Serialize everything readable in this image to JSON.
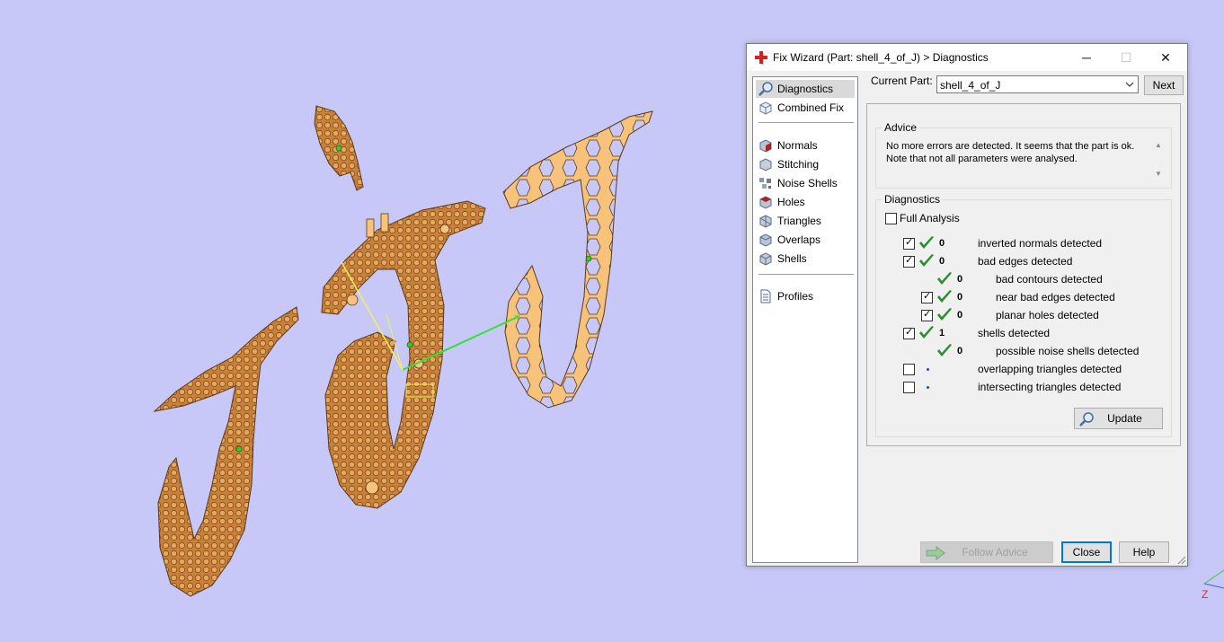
{
  "dialog": {
    "title": "Fix Wizard (Part: shell_4_of_J) > Diagnostics",
    "window_controls": {
      "minimize": "─",
      "maximize": "☐",
      "close": "✕"
    }
  },
  "nav": {
    "top_items": [
      {
        "label": "Diagnostics",
        "icon": "magnifier-icon",
        "selected": true
      },
      {
        "label": "Combined Fix",
        "icon": "cube-wire-icon"
      }
    ],
    "fix_items": [
      {
        "label": "Normals",
        "icon": "normals-icon"
      },
      {
        "label": "Stitching",
        "icon": "stitching-icon"
      },
      {
        "label": "Noise Shells",
        "icon": "noise-shells-icon"
      },
      {
        "label": "Holes",
        "icon": "holes-icon"
      },
      {
        "label": "Triangles",
        "icon": "triangles-icon"
      },
      {
        "label": "Overlaps",
        "icon": "overlaps-icon"
      },
      {
        "label": "Shells",
        "icon": "shells-icon"
      }
    ],
    "bottom_items": [
      {
        "label": "Profiles",
        "icon": "document-icon"
      }
    ]
  },
  "current_part": {
    "label": "Current Part:",
    "value": "shell_4_of_J"
  },
  "buttons": {
    "next": "Next",
    "update": "Update",
    "follow_advice": "Follow Advice",
    "close": "Close",
    "help": "Help"
  },
  "advice": {
    "title": "Advice",
    "lines": [
      "No more errors are detected. It seems that the part is ok.",
      "Note that not all parameters were analysed."
    ]
  },
  "diagnostics": {
    "title": "Diagnostics",
    "full_analysis": {
      "label": "Full Analysis",
      "checked": false
    },
    "rows": [
      {
        "label": "inverted normals detected",
        "count": "0",
        "checked": true,
        "status": "ok",
        "indent": 0
      },
      {
        "label": "bad edges detected",
        "count": "0",
        "checked": true,
        "status": "ok",
        "indent": 0
      },
      {
        "label": "bad contours detected",
        "count": "0",
        "checked": null,
        "status": "ok",
        "indent": 1
      },
      {
        "label": "near bad edges detected",
        "count": "0",
        "checked": true,
        "status": "ok",
        "indent": 1
      },
      {
        "label": "planar holes detected",
        "count": "0",
        "checked": true,
        "status": "ok",
        "indent": 1
      },
      {
        "label": "shells detected",
        "count": "1",
        "checked": true,
        "status": "ok",
        "indent": 0
      },
      {
        "label": "possible noise shells detected",
        "count": "0",
        "checked": null,
        "status": "ok",
        "indent": 1
      },
      {
        "label": "overlapping triangles detected",
        "count": "",
        "checked": false,
        "status": "pending",
        "indent": 0
      },
      {
        "label": "intersecting triangles detected",
        "count": "",
        "checked": false,
        "status": "pending",
        "indent": 0
      }
    ]
  },
  "viewport": {
    "background": "#c8c8f8",
    "axis_label": "Z"
  },
  "colors": {
    "ok_green": "#2e8b2e",
    "part_fill": "#f7c27a",
    "part_dark": "#c87a2e",
    "gizmo_green": "#33e033",
    "gizmo_yellow": "#f0f060"
  }
}
